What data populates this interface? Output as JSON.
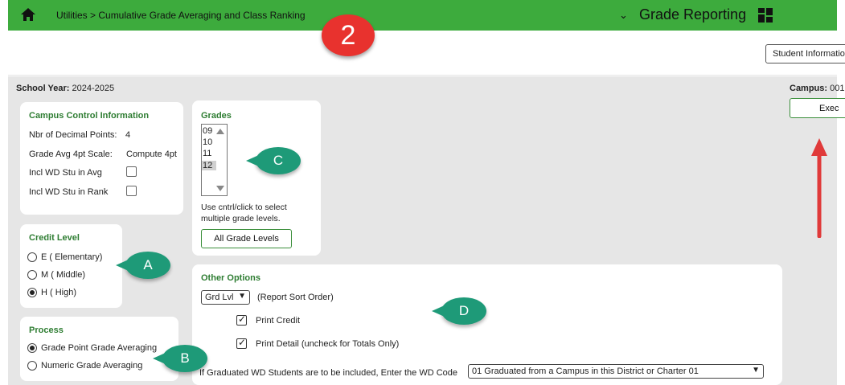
{
  "header": {
    "breadcrumb": "Utilities > Cumulative Grade Averaging and Class Ranking",
    "module": "Grade Reporting",
    "student_info_button": "Student Informatio"
  },
  "step_badge": "2",
  "school_year": {
    "label": "School Year:",
    "value": "2024-2025"
  },
  "campus": {
    "label": "Campus:",
    "value": "001"
  },
  "execute_label": "Exec",
  "campus_control": {
    "title": "Campus Control Information",
    "decimal_label": "Nbr of Decimal Points:",
    "decimal_value": "4",
    "gpa_scale_label": "Grade Avg 4pt Scale:",
    "gpa_scale_value": "Compute 4pt",
    "incl_avg_label": "Incl WD Stu in Avg",
    "incl_rank_label": "Incl WD Stu in Rank"
  },
  "grades": {
    "title": "Grades",
    "items": [
      "09",
      "10",
      "11",
      "12"
    ],
    "selected": "12",
    "hint_line1": "Use cntrl/click to select",
    "hint_line2": "multiple grade levels.",
    "all_button": "All Grade Levels"
  },
  "credit_level": {
    "title": "Credit Level",
    "options": [
      {
        "label": "E ( Elementary)",
        "checked": false
      },
      {
        "label": "M ( Middle)",
        "checked": false
      },
      {
        "label": "H ( High)",
        "checked": true
      }
    ]
  },
  "process": {
    "title": "Process",
    "options": [
      {
        "label": "Grade Point Grade Averaging",
        "checked": true
      },
      {
        "label": "Numeric Grade Averaging",
        "checked": false
      }
    ]
  },
  "other_options": {
    "title": "Other Options",
    "sort_value": "Grd Lvl",
    "sort_label": "(Report Sort Order)",
    "print_credit": "Print Credit",
    "print_detail": "Print Detail (uncheck for Totals Only)",
    "wd_label": "If Graduated WD Students are to be included, Enter the WD Code",
    "wd_value": "01 Graduated from a Campus in this District or Charter 01"
  },
  "callouts": {
    "a": "A",
    "b": "B",
    "c": "C",
    "d": "D"
  },
  "colors": {
    "header_green": "#3dab3d",
    "title_green": "#2e7d32",
    "callout_teal": "#1e9a78",
    "badge_red": "#e8322e"
  }
}
